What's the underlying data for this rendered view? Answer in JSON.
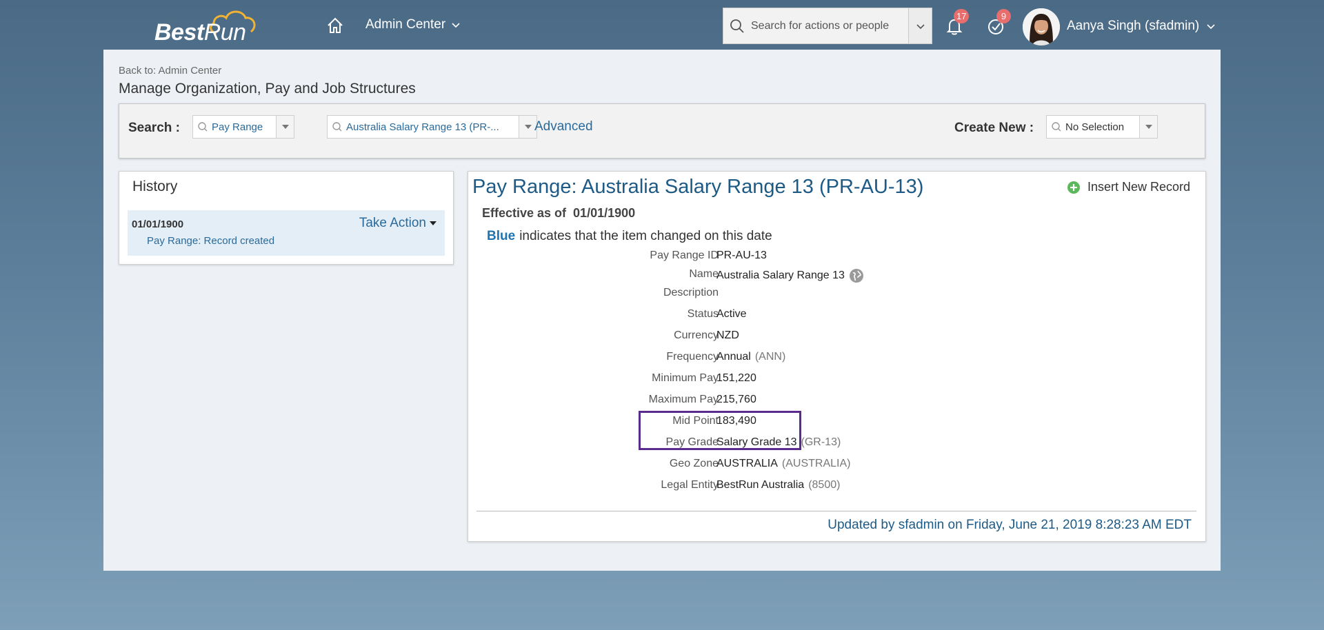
{
  "header": {
    "logo_bold": "Best",
    "logo_light": "Run",
    "admin_center_label": "Admin Center",
    "search_placeholder": "Search for actions or people",
    "notifications_count": "17",
    "tasks_count": "9",
    "user_name": "Aanya Singh (sfadmin)"
  },
  "page": {
    "back_link": "Back to: Admin Center",
    "title": "Manage Organization, Pay and Job Structures"
  },
  "search_panel": {
    "search_label": "Search :",
    "type_value": "Pay Range",
    "record_value": "Australia Salary Range 13 (PR-...",
    "advanced_label": "Advanced",
    "create_new_label": "Create New :",
    "create_new_value": "No Selection"
  },
  "history": {
    "title": "History",
    "entries": [
      {
        "date": "01/01/1900",
        "action_label": "Take Action",
        "description": "Pay Range: Record created"
      }
    ]
  },
  "record": {
    "title": "Pay Range: Australia Salary Range 13 (PR-AU-13)",
    "insert_label": "Insert New Record",
    "effective_label": "Effective as of",
    "effective_date": "01/01/1900",
    "legend_blue": "Blue",
    "legend_text": "indicates that the item changed on this date",
    "fields": [
      {
        "label": "Pay Range ID",
        "value": "PR-AU-13",
        "code": ""
      },
      {
        "label": "Name",
        "value": "Australia Salary Range 13",
        "code": ""
      },
      {
        "label": "Description",
        "value": "",
        "code": ""
      },
      {
        "label": "Status",
        "value": "Active",
        "code": ""
      },
      {
        "label": "Currency",
        "value": "NZD",
        "code": ""
      },
      {
        "label": "Frequency",
        "value": "Annual",
        "code": "(ANN)"
      },
      {
        "label": "Minimum Pay",
        "value": "151,220",
        "code": ""
      },
      {
        "label": "Maximum Pay",
        "value": "215,760",
        "code": ""
      },
      {
        "label": "Mid Point",
        "value": "183,490",
        "code": ""
      },
      {
        "label": "Pay Grade",
        "value": "Salary Grade 13",
        "code": "(GR-13)"
      },
      {
        "label": "Geo Zone",
        "value": "AUSTRALIA",
        "code": "(AUSTRALIA)"
      },
      {
        "label": "Legal Entity",
        "value": "BestRun Australia",
        "code": "(8500)"
      }
    ],
    "updated_text": "Updated by sfadmin on Friday, June 21, 2019 8:28:23 AM EDT"
  },
  "colors": {
    "link_blue": "#2a6a9a",
    "title_blue": "#1d5a86",
    "badge_red": "#e86d6d",
    "highlight_purple": "#5a2a8c"
  }
}
